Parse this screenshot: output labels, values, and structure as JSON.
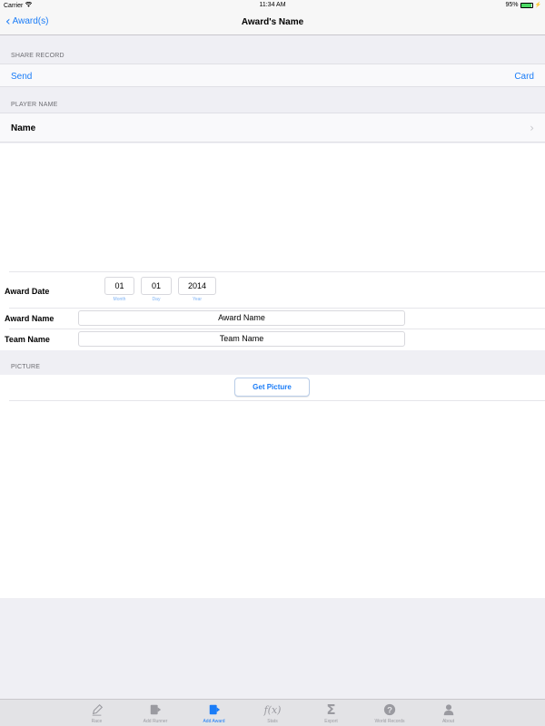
{
  "status_bar": {
    "carrier": "Carrier",
    "time": "11:34 AM",
    "battery": "95%",
    "battery_level": 0.95
  },
  "nav": {
    "back_label": "Award(s)",
    "title": "Award's Name"
  },
  "share_section": {
    "header": "SHARE RECORD",
    "send_label": "Send",
    "card_label": "Card"
  },
  "player_section": {
    "header": "PLAYER NAME",
    "name_label": "Name"
  },
  "award_date": {
    "label": "Award Date",
    "month": "01",
    "day": "01",
    "year": "2014",
    "month_caption": "Month",
    "day_caption": "Day",
    "year_caption": "Year"
  },
  "award_name": {
    "label": "Award Name",
    "value": "Award Name"
  },
  "team_name": {
    "label": "Team Name",
    "value": "Team Name"
  },
  "picture_section": {
    "header": "PICTURE",
    "button_label": "Get Picture"
  },
  "tabs": [
    {
      "label": "Race",
      "icon": "pen-icon"
    },
    {
      "label": "Add Runner",
      "icon": "add-runner-icon"
    },
    {
      "label": "Add Award",
      "icon": "add-award-icon",
      "active": true
    },
    {
      "label": "Stats",
      "icon": "function-icon"
    },
    {
      "label": "Export",
      "icon": "sigma-icon"
    },
    {
      "label": "World Records",
      "icon": "question-icon"
    },
    {
      "label": "About",
      "icon": "person-icon"
    }
  ],
  "colors": {
    "accent": "#1a7cf7",
    "background": "#efeff4",
    "tab_inactive": "#9a9aa0"
  }
}
